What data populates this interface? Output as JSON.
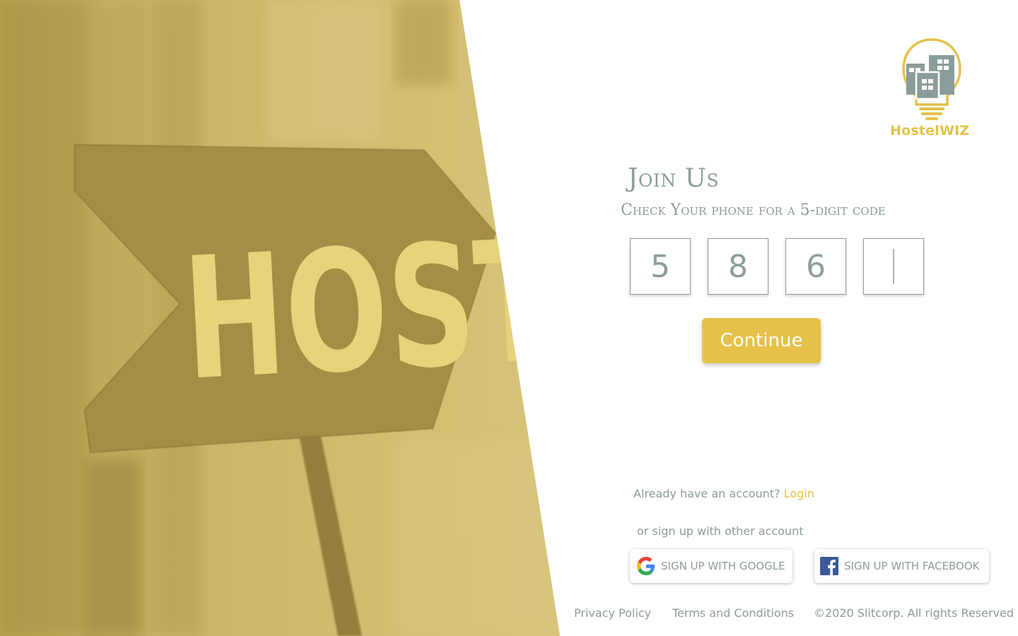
{
  "brand": {
    "name_part1": "Hostel",
    "name_part2": "WIZ",
    "accent_color": "#e5c14a",
    "slate_color": "#8b9d9a"
  },
  "hero": {
    "sign_text": "HOSTEL",
    "overlay_color": "#d2bd70"
  },
  "form": {
    "title": "Join Us",
    "subtitle": "Check Your phone for a 5-digit code",
    "code_digits": [
      "5",
      "8",
      "6",
      ""
    ],
    "continue_label": "Continue"
  },
  "account": {
    "prompt": "Already have an account?",
    "login_label": "Login",
    "other_text": "or sign up with other account"
  },
  "social": {
    "google_label": "SIGN UP WITH GOOGLE",
    "google_icon": "google-icon",
    "facebook_label": "SIGN UP WITH FACEBOOK",
    "facebook_icon": "facebook-icon"
  },
  "footer": {
    "privacy": "Privacy Policy",
    "terms": "Terms and Conditions",
    "copyright": "©2020 Slitcorp. All rights Reserved"
  }
}
